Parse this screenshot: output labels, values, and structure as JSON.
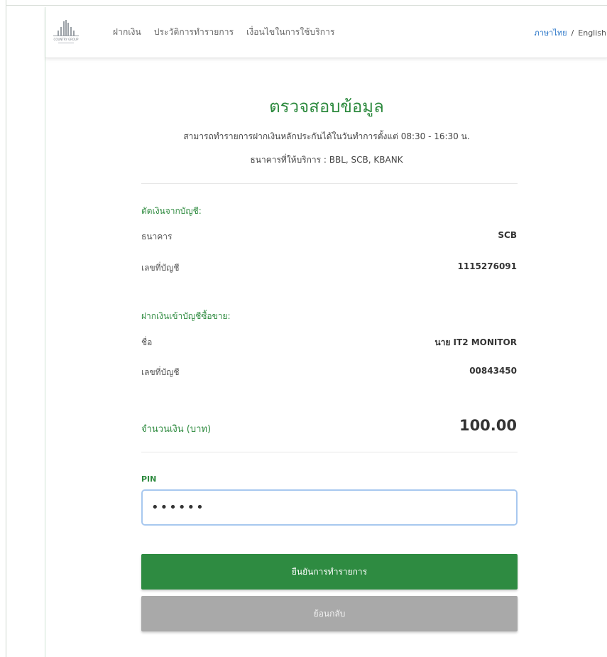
{
  "navbar": {
    "logo_icon": "building-logo-icon",
    "logo_text": "COUNTRY GROUP",
    "links": [
      "ฝากเงิน",
      "ประวัติการทำรายการ",
      "เงื่อนไขในการใช้บริการ"
    ],
    "lang_th": "ภาษาไทย",
    "lang_sep": "/",
    "lang_en": "English"
  },
  "header": {
    "title": "ตรวจสอบข้อมูล",
    "subtitle": "สามารถทำรายการฝากเงินหลักประกันได้ในวันทำการตั้งแต่ 08:30 - 16:30 น.",
    "banks_note": "ธนาคารที่ให้บริการ : BBL, SCB, KBANK"
  },
  "debit": {
    "section_title": "ตัดเงินจากบัญชี:",
    "bank_label": "ธนาคาร",
    "bank_value": "SCB",
    "account_label": "เลขที่บัญชี",
    "account_value": "1115276091"
  },
  "deposit": {
    "section_title": "ฝากเงินเข้าบัญชีซื้อขาย:",
    "name_label": "ชื่อ",
    "name_value": "นาย IT2 MONITOR",
    "account_label": "เลขที่บัญชี",
    "account_value": "00843450"
  },
  "amount": {
    "label": "จำนวนเงิน (บาท)",
    "value": "100.00"
  },
  "pin": {
    "label": "PIN",
    "value": "••••••"
  },
  "buttons": {
    "confirm": "ยืนยันการทำรายการ",
    "back": "ย้อนกลับ"
  },
  "colors": {
    "accent_green": "#2e8b41",
    "link_blue": "#2a76c8",
    "back_gray": "#a9a9a9"
  }
}
